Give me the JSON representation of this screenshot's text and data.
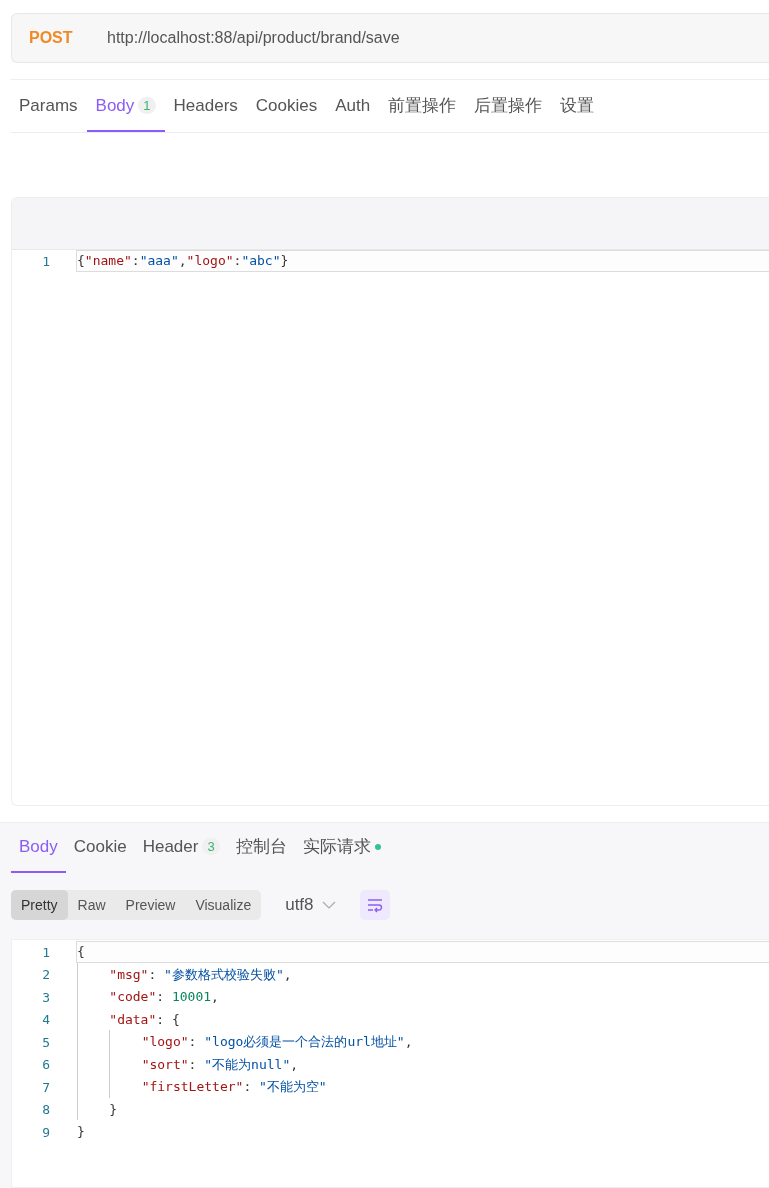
{
  "request": {
    "method": "POST",
    "url": "http://localhost:88/api/product/brand/save"
  },
  "request_tabs": [
    {
      "label": "Params",
      "selected": false
    },
    {
      "label": "Body",
      "badge": "1",
      "selected": true
    },
    {
      "label": "Headers",
      "selected": false
    },
    {
      "label": "Cookies",
      "selected": false
    },
    {
      "label": "Auth",
      "selected": false
    },
    {
      "label": "前置操作",
      "selected": false
    },
    {
      "label": "后置操作",
      "selected": false
    },
    {
      "label": "设置",
      "selected": false
    }
  ],
  "request_body": {
    "lines": [
      {
        "number": "1",
        "current": true,
        "tokens": [
          {
            "kind": "punct",
            "text": "{"
          },
          {
            "kind": "key",
            "text": "\"name\""
          },
          {
            "kind": "punct",
            "text": ":"
          },
          {
            "kind": "string",
            "text": "\"aaa\""
          },
          {
            "kind": "punct",
            "text": ","
          },
          {
            "kind": "key",
            "text": "\"logo\""
          },
          {
            "kind": "punct",
            "text": ":"
          },
          {
            "kind": "string",
            "text": "\"abc\""
          },
          {
            "kind": "punct",
            "text": "}"
          }
        ]
      }
    ]
  },
  "response_tabs": [
    {
      "label": "Body",
      "selected": true
    },
    {
      "label": "Cookie",
      "selected": false
    },
    {
      "label": "Header",
      "badge": "3",
      "selected": false
    },
    {
      "label": "控制台",
      "selected": false
    },
    {
      "label": "实际请求",
      "dot": true,
      "selected": false
    }
  ],
  "view_modes": [
    {
      "label": "Pretty",
      "selected": true
    },
    {
      "label": "Raw",
      "selected": false
    },
    {
      "label": "Preview",
      "selected": false
    },
    {
      "label": "Visualize",
      "selected": false
    }
  ],
  "encoding": "utf8",
  "wrap": {
    "on": true
  },
  "response_body": {
    "lines": [
      {
        "number": "1",
        "current": true,
        "tokens": [
          {
            "kind": "punct",
            "text": "{"
          }
        ],
        "children": [
          {
            "number": "2",
            "current": false,
            "tokens": [
              {
                "kind": "key",
                "text": "\"msg\""
              },
              {
                "kind": "punct",
                "text": ": "
              },
              {
                "kind": "string",
                "text": "\"参数格式校验失败\""
              },
              {
                "kind": "punct",
                "text": ","
              }
            ]
          },
          {
            "number": "3",
            "current": false,
            "tokens": [
              {
                "kind": "key",
                "text": "\"code\""
              },
              {
                "kind": "punct",
                "text": ": "
              },
              {
                "kind": "number",
                "text": "10001"
              },
              {
                "kind": "punct",
                "text": ","
              }
            ]
          },
          {
            "number": "4",
            "current": false,
            "tokens": [
              {
                "kind": "key",
                "text": "\"data\""
              },
              {
                "kind": "punct",
                "text": ": {"
              }
            ],
            "children": [
              {
                "number": "5",
                "current": false,
                "tokens": [
                  {
                    "kind": "key",
                    "text": "\"logo\""
                  },
                  {
                    "kind": "punct",
                    "text": ": "
                  },
                  {
                    "kind": "string",
                    "text": "\"logo必须是一个合法的url地址\""
                  },
                  {
                    "kind": "punct",
                    "text": ","
                  }
                ]
              },
              {
                "number": "6",
                "current": false,
                "tokens": [
                  {
                    "kind": "key",
                    "text": "\"sort\""
                  },
                  {
                    "kind": "punct",
                    "text": ": "
                  },
                  {
                    "kind": "string",
                    "text": "\"不能为null\""
                  },
                  {
                    "kind": "punct",
                    "text": ","
                  }
                ]
              },
              {
                "number": "7",
                "current": false,
                "tokens": [
                  {
                    "kind": "key",
                    "text": "\"firstLetter\""
                  },
                  {
                    "kind": "punct",
                    "text": ": "
                  },
                  {
                    "kind": "string",
                    "text": "\"不能为空\""
                  }
                ]
              }
            ]
          },
          {
            "number": "8",
            "current": false,
            "tokens": [
              {
                "kind": "punct",
                "text": "}"
              }
            ]
          }
        ]
      },
      {
        "number": "9",
        "current": false,
        "tokens": [
          {
            "kind": "punct",
            "text": "}"
          }
        ]
      }
    ]
  }
}
